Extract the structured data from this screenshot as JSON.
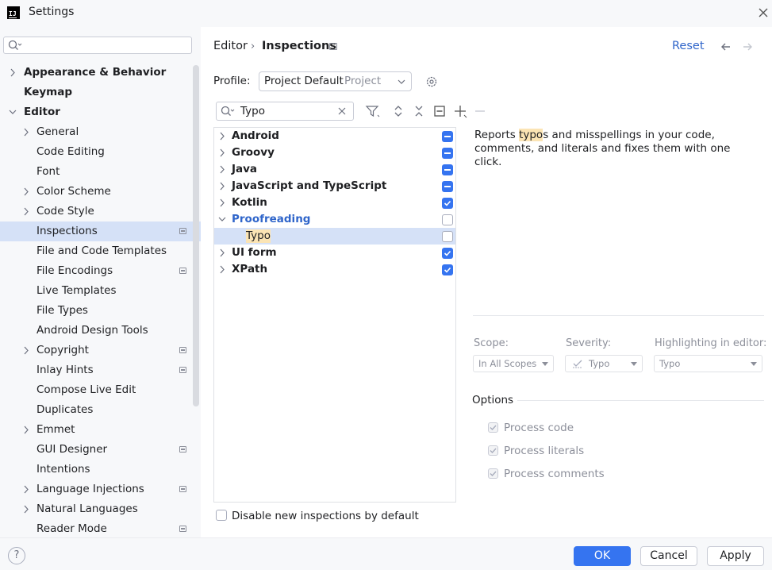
{
  "window": {
    "title": "Settings",
    "logo_text": "IJ"
  },
  "search": {
    "placeholder": "",
    "value": ""
  },
  "sidebar": {
    "items": [
      {
        "label": "Appearance & Behavior",
        "level": 0,
        "chevron": true,
        "bold": true,
        "selected": false,
        "project": false
      },
      {
        "label": "Keymap",
        "level": 0,
        "chevron": false,
        "bold": true,
        "selected": false,
        "project": false
      },
      {
        "label": "Editor",
        "level": 0,
        "chevron": true,
        "expanded": true,
        "bold": true,
        "selected": false,
        "project": false
      },
      {
        "label": "General",
        "level": 1,
        "chevron": true,
        "bold": false,
        "selected": false,
        "project": false
      },
      {
        "label": "Code Editing",
        "level": 1,
        "chevron": false,
        "bold": false,
        "selected": false,
        "project": false
      },
      {
        "label": "Font",
        "level": 1,
        "chevron": false,
        "bold": false,
        "selected": false,
        "project": false
      },
      {
        "label": "Color Scheme",
        "level": 1,
        "chevron": true,
        "bold": false,
        "selected": false,
        "project": false
      },
      {
        "label": "Code Style",
        "level": 1,
        "chevron": true,
        "bold": false,
        "selected": false,
        "project": false
      },
      {
        "label": "Inspections",
        "level": 1,
        "chevron": false,
        "bold": false,
        "selected": true,
        "project": true
      },
      {
        "label": "File and Code Templates",
        "level": 1,
        "chevron": false,
        "bold": false,
        "selected": false,
        "project": false
      },
      {
        "label": "File Encodings",
        "level": 1,
        "chevron": false,
        "bold": false,
        "selected": false,
        "project": true
      },
      {
        "label": "Live Templates",
        "level": 1,
        "chevron": false,
        "bold": false,
        "selected": false,
        "project": false
      },
      {
        "label": "File Types",
        "level": 1,
        "chevron": false,
        "bold": false,
        "selected": false,
        "project": false
      },
      {
        "label": "Android Design Tools",
        "level": 1,
        "chevron": false,
        "bold": false,
        "selected": false,
        "project": false
      },
      {
        "label": "Copyright",
        "level": 1,
        "chevron": true,
        "bold": false,
        "selected": false,
        "project": true
      },
      {
        "label": "Inlay Hints",
        "level": 1,
        "chevron": false,
        "bold": false,
        "selected": false,
        "project": true
      },
      {
        "label": "Compose Live Edit",
        "level": 1,
        "chevron": false,
        "bold": false,
        "selected": false,
        "project": false
      },
      {
        "label": "Duplicates",
        "level": 1,
        "chevron": false,
        "bold": false,
        "selected": false,
        "project": false
      },
      {
        "label": "Emmet",
        "level": 1,
        "chevron": true,
        "bold": false,
        "selected": false,
        "project": false
      },
      {
        "label": "GUI Designer",
        "level": 1,
        "chevron": false,
        "bold": false,
        "selected": false,
        "project": true
      },
      {
        "label": "Intentions",
        "level": 1,
        "chevron": false,
        "bold": false,
        "selected": false,
        "project": false
      },
      {
        "label": "Language Injections",
        "level": 1,
        "chevron": true,
        "bold": false,
        "selected": false,
        "project": true
      },
      {
        "label": "Natural Languages",
        "level": 1,
        "chevron": true,
        "bold": false,
        "selected": false,
        "project": false
      },
      {
        "label": "Reader Mode",
        "level": 1,
        "chevron": false,
        "bold": false,
        "selected": false,
        "project": true
      }
    ]
  },
  "header": {
    "breadcrumb": [
      "Editor",
      "Inspections"
    ],
    "reset_label": "Reset"
  },
  "profile": {
    "label": "Profile:",
    "value": "Project Default",
    "scope_hint": "Project"
  },
  "filter": {
    "value": "Typo"
  },
  "inspections": [
    {
      "label": "Android",
      "state": "partial",
      "expanded": false,
      "link": false
    },
    {
      "label": "Groovy",
      "state": "partial",
      "expanded": false,
      "link": false
    },
    {
      "label": "Java",
      "state": "partial",
      "expanded": false,
      "link": false
    },
    {
      "label": "JavaScript and TypeScript",
      "state": "partial",
      "expanded": false,
      "link": false
    },
    {
      "label": "Kotlin",
      "state": "checked",
      "expanded": false,
      "link": false
    },
    {
      "label": "Proofreading",
      "state": "unchecked",
      "expanded": true,
      "link": true
    },
    {
      "label": "Typo",
      "state": "unchecked",
      "child": true,
      "selected": true
    },
    {
      "label": "UI form",
      "state": "checked",
      "expanded": false,
      "link": false
    },
    {
      "label": "XPath",
      "state": "checked",
      "expanded": false,
      "link": false
    }
  ],
  "description": {
    "pre": "Reports ",
    "highlight": "typo",
    "post": "s and misspellings in your code, comments, and literals and fixes them with one click."
  },
  "scope": {
    "label": "Scope:",
    "value": "In All Scopes"
  },
  "severity": {
    "label": "Severity:",
    "value": "Typo"
  },
  "highlighting": {
    "label": "Highlighting in editor:",
    "value": "Typo"
  },
  "options": {
    "title": "Options",
    "items": [
      {
        "label": "Process code",
        "checked": true
      },
      {
        "label": "Process literals",
        "checked": true
      },
      {
        "label": "Process comments",
        "checked": true
      }
    ]
  },
  "disable_new": {
    "label": "Disable new inspections by default",
    "checked": false
  },
  "buttons": {
    "ok": "OK",
    "cancel": "Cancel",
    "apply": "Apply"
  },
  "colors": {
    "accent": "#3574f0",
    "selection": "#d5e1f7",
    "link": "#2f65ca",
    "highlight": "#fbe4b4"
  }
}
